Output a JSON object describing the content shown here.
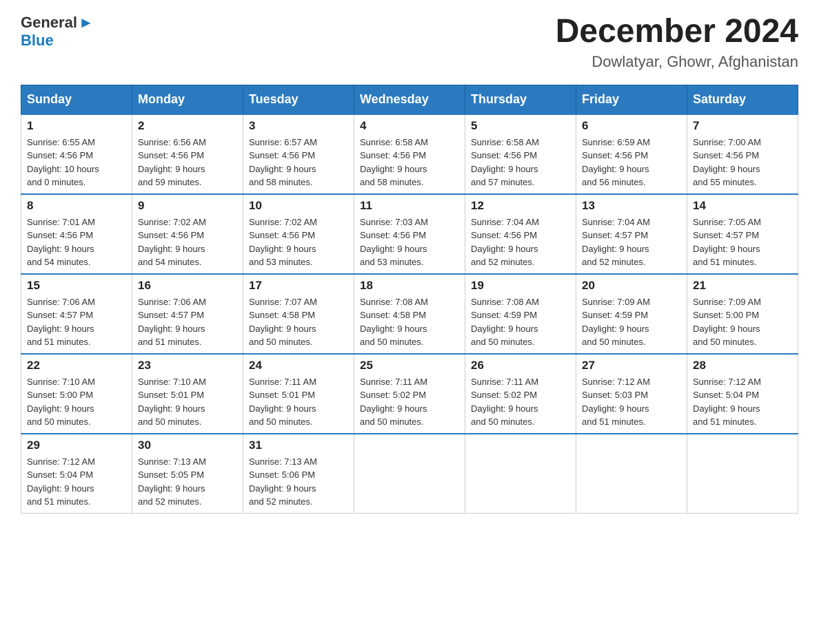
{
  "header": {
    "logo_line1": "General",
    "logo_line2": "Blue",
    "month_title": "December 2024",
    "location": "Dowlatyar, Ghowr, Afghanistan"
  },
  "days_of_week": [
    "Sunday",
    "Monday",
    "Tuesday",
    "Wednesday",
    "Thursday",
    "Friday",
    "Saturday"
  ],
  "weeks": [
    [
      {
        "day": "1",
        "sunrise": "6:55 AM",
        "sunset": "4:56 PM",
        "daylight": "10 hours and 0 minutes."
      },
      {
        "day": "2",
        "sunrise": "6:56 AM",
        "sunset": "4:56 PM",
        "daylight": "9 hours and 59 minutes."
      },
      {
        "day": "3",
        "sunrise": "6:57 AM",
        "sunset": "4:56 PM",
        "daylight": "9 hours and 58 minutes."
      },
      {
        "day": "4",
        "sunrise": "6:58 AM",
        "sunset": "4:56 PM",
        "daylight": "9 hours and 58 minutes."
      },
      {
        "day": "5",
        "sunrise": "6:58 AM",
        "sunset": "4:56 PM",
        "daylight": "9 hours and 57 minutes."
      },
      {
        "day": "6",
        "sunrise": "6:59 AM",
        "sunset": "4:56 PM",
        "daylight": "9 hours and 56 minutes."
      },
      {
        "day": "7",
        "sunrise": "7:00 AM",
        "sunset": "4:56 PM",
        "daylight": "9 hours and 55 minutes."
      }
    ],
    [
      {
        "day": "8",
        "sunrise": "7:01 AM",
        "sunset": "4:56 PM",
        "daylight": "9 hours and 54 minutes."
      },
      {
        "day": "9",
        "sunrise": "7:02 AM",
        "sunset": "4:56 PM",
        "daylight": "9 hours and 54 minutes."
      },
      {
        "day": "10",
        "sunrise": "7:02 AM",
        "sunset": "4:56 PM",
        "daylight": "9 hours and 53 minutes."
      },
      {
        "day": "11",
        "sunrise": "7:03 AM",
        "sunset": "4:56 PM",
        "daylight": "9 hours and 53 minutes."
      },
      {
        "day": "12",
        "sunrise": "7:04 AM",
        "sunset": "4:56 PM",
        "daylight": "9 hours and 52 minutes."
      },
      {
        "day": "13",
        "sunrise": "7:04 AM",
        "sunset": "4:57 PM",
        "daylight": "9 hours and 52 minutes."
      },
      {
        "day": "14",
        "sunrise": "7:05 AM",
        "sunset": "4:57 PM",
        "daylight": "9 hours and 51 minutes."
      }
    ],
    [
      {
        "day": "15",
        "sunrise": "7:06 AM",
        "sunset": "4:57 PM",
        "daylight": "9 hours and 51 minutes."
      },
      {
        "day": "16",
        "sunrise": "7:06 AM",
        "sunset": "4:57 PM",
        "daylight": "9 hours and 51 minutes."
      },
      {
        "day": "17",
        "sunrise": "7:07 AM",
        "sunset": "4:58 PM",
        "daylight": "9 hours and 50 minutes."
      },
      {
        "day": "18",
        "sunrise": "7:08 AM",
        "sunset": "4:58 PM",
        "daylight": "9 hours and 50 minutes."
      },
      {
        "day": "19",
        "sunrise": "7:08 AM",
        "sunset": "4:59 PM",
        "daylight": "9 hours and 50 minutes."
      },
      {
        "day": "20",
        "sunrise": "7:09 AM",
        "sunset": "4:59 PM",
        "daylight": "9 hours and 50 minutes."
      },
      {
        "day": "21",
        "sunrise": "7:09 AM",
        "sunset": "5:00 PM",
        "daylight": "9 hours and 50 minutes."
      }
    ],
    [
      {
        "day": "22",
        "sunrise": "7:10 AM",
        "sunset": "5:00 PM",
        "daylight": "9 hours and 50 minutes."
      },
      {
        "day": "23",
        "sunrise": "7:10 AM",
        "sunset": "5:01 PM",
        "daylight": "9 hours and 50 minutes."
      },
      {
        "day": "24",
        "sunrise": "7:11 AM",
        "sunset": "5:01 PM",
        "daylight": "9 hours and 50 minutes."
      },
      {
        "day": "25",
        "sunrise": "7:11 AM",
        "sunset": "5:02 PM",
        "daylight": "9 hours and 50 minutes."
      },
      {
        "day": "26",
        "sunrise": "7:11 AM",
        "sunset": "5:02 PM",
        "daylight": "9 hours and 50 minutes."
      },
      {
        "day": "27",
        "sunrise": "7:12 AM",
        "sunset": "5:03 PM",
        "daylight": "9 hours and 51 minutes."
      },
      {
        "day": "28",
        "sunrise": "7:12 AM",
        "sunset": "5:04 PM",
        "daylight": "9 hours and 51 minutes."
      }
    ],
    [
      {
        "day": "29",
        "sunrise": "7:12 AM",
        "sunset": "5:04 PM",
        "daylight": "9 hours and 51 minutes."
      },
      {
        "day": "30",
        "sunrise": "7:13 AM",
        "sunset": "5:05 PM",
        "daylight": "9 hours and 52 minutes."
      },
      {
        "day": "31",
        "sunrise": "7:13 AM",
        "sunset": "5:06 PM",
        "daylight": "9 hours and 52 minutes."
      },
      null,
      null,
      null,
      null
    ]
  ],
  "labels": {
    "sunrise": "Sunrise:",
    "sunset": "Sunset:",
    "daylight": "Daylight:"
  }
}
